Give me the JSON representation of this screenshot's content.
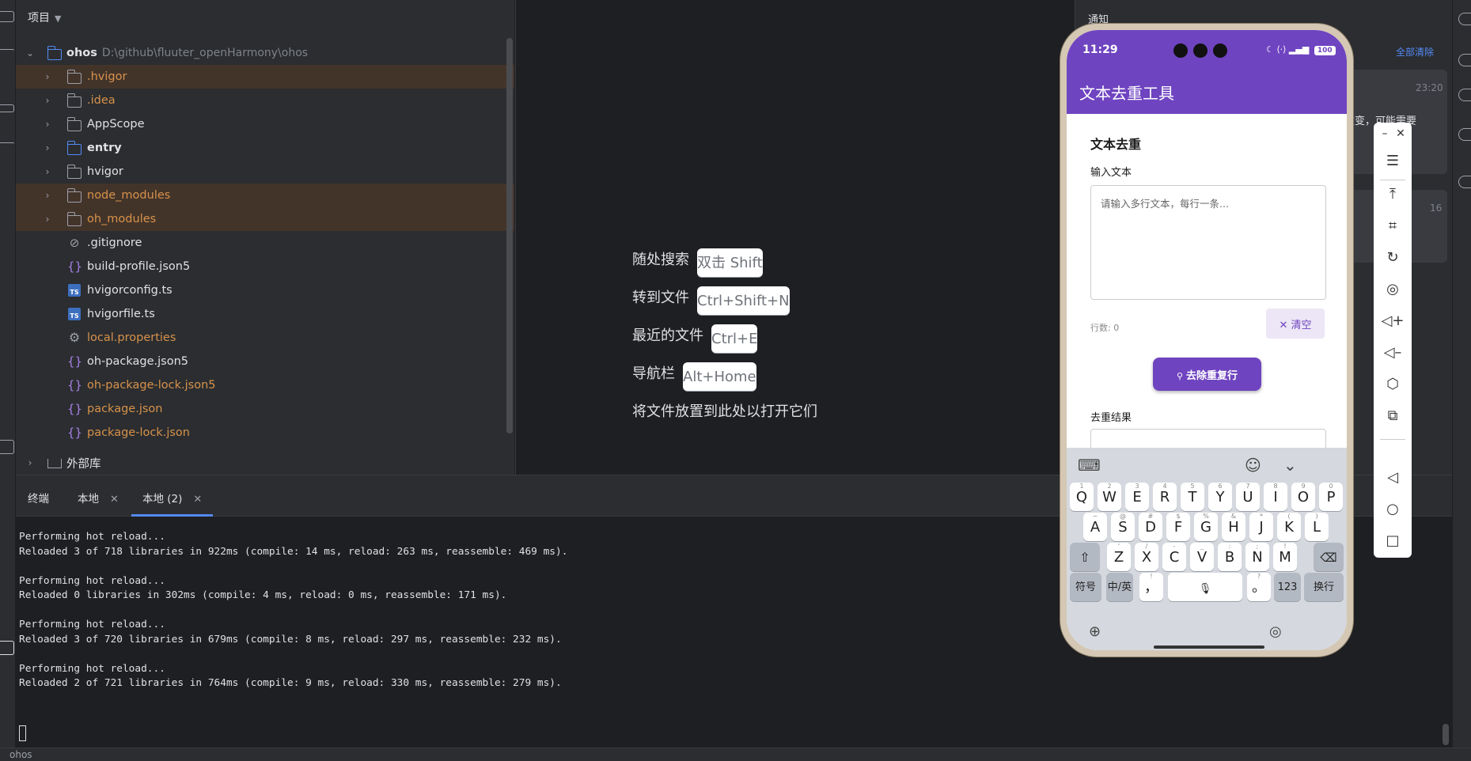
{
  "project_panel": {
    "title": "项目",
    "root": {
      "name": "ohos",
      "path": "D:\\github\\fluuter_openHarmony\\ohos"
    },
    "items": [
      {
        "label": ".hvigor",
        "type": "folder",
        "color": "#d7924b",
        "highlighted": true,
        "expandable": true
      },
      {
        "label": ".idea",
        "type": "folder",
        "color": "#d7924b",
        "highlighted": false,
        "expandable": true
      },
      {
        "label": "AppScope",
        "type": "folder",
        "color": "#dfe1e5",
        "highlighted": false,
        "expandable": true
      },
      {
        "label": "entry",
        "type": "module",
        "color": "#dfe1e5",
        "highlighted": false,
        "expandable": true
      },
      {
        "label": "hvigor",
        "type": "folder",
        "color": "#dfe1e5",
        "highlighted": false,
        "expandable": true
      },
      {
        "label": "node_modules",
        "type": "folder",
        "color": "#d7924b",
        "highlighted": true,
        "expandable": true
      },
      {
        "label": "oh_modules",
        "type": "folder",
        "color": "#d7924b",
        "highlighted": true,
        "expandable": true
      },
      {
        "label": ".gitignore",
        "type": "ignore",
        "color": "#dfe1e5",
        "highlighted": false,
        "expandable": false
      },
      {
        "label": "build-profile.json5",
        "type": "json",
        "color": "#dfe1e5",
        "highlighted": false,
        "expandable": false
      },
      {
        "label": "hvigorconfig.ts",
        "type": "ts",
        "color": "#dfe1e5",
        "highlighted": false,
        "expandable": false
      },
      {
        "label": "hvigorfile.ts",
        "type": "ts",
        "color": "#dfe1e5",
        "highlighted": false,
        "expandable": false
      },
      {
        "label": "local.properties",
        "type": "properties",
        "color": "#d7924b",
        "highlighted": false,
        "expandable": false
      },
      {
        "label": "oh-package.json5",
        "type": "json",
        "color": "#dfe1e5",
        "highlighted": false,
        "expandable": false
      },
      {
        "label": "oh-package-lock.json5",
        "type": "json",
        "color": "#d7924b",
        "highlighted": false,
        "expandable": false
      },
      {
        "label": "package.json",
        "type": "json",
        "color": "#d7924b",
        "highlighted": false,
        "expandable": false
      },
      {
        "label": "package-lock.json",
        "type": "json",
        "color": "#d7924b",
        "highlighted": false,
        "expandable": false
      }
    ],
    "external_libs": "外部库"
  },
  "editor_hints": [
    {
      "label": "随处搜索",
      "key": "双击 Shift"
    },
    {
      "label": "转到文件",
      "key": "Ctrl+Shift+N"
    },
    {
      "label": "最近的文件",
      "key": "Ctrl+E"
    },
    {
      "label": "导航栏",
      "key": "Alt+Home"
    },
    {
      "label": "将文件放置到此处以打开它们",
      "key": ""
    }
  ],
  "notifications": {
    "title": "通知",
    "clear_all": "全部清除",
    "card1_time": "23:20",
    "card1_text": "改变，可能需要",
    "card2_time": "16"
  },
  "terminal": {
    "title": "终端",
    "tabs": [
      {
        "label": "本地",
        "active": false
      },
      {
        "label": "本地 (2)",
        "active": true
      }
    ],
    "lines": [
      "Performing hot reload...",
      "Reloaded 3 of 718 libraries in 922ms (compile: 14 ms, reload: 263 ms, reassemble: 469 ms).",
      "",
      "Performing hot reload...",
      "Reloaded 0 libraries in 302ms (compile: 4 ms, reload: 0 ms, reassemble: 171 ms).",
      "",
      "Performing hot reload...",
      "Reloaded 3 of 720 libraries in 679ms (compile: 8 ms, reload: 297 ms, reassemble: 232 ms).",
      "",
      "Performing hot reload...",
      "Reloaded 2 of 721 libraries in 764ms (compile: 9 ms, reload: 330 ms, reassemble: 279 ms)."
    ]
  },
  "status_bar": {
    "project": "ohos"
  },
  "phone": {
    "time": "11:29",
    "battery": "100",
    "app_title": "文本去重工具",
    "section_title": "文本去重",
    "input_label": "输入文本",
    "input_placeholder": "请输入多行文本，每行一条...",
    "input_value": "",
    "line_count": "行数: 0",
    "clear_label": "清空",
    "dedupe_label": "去除重复行",
    "result_label": "去重结果",
    "accent": "#6f44c0"
  },
  "keyboard": {
    "row1": [
      [
        "Q",
        "1"
      ],
      [
        "W",
        "2"
      ],
      [
        "E",
        "3"
      ],
      [
        "R",
        "4"
      ],
      [
        "T",
        "5"
      ],
      [
        "Y",
        "6"
      ],
      [
        "U",
        "7"
      ],
      [
        "I",
        "8"
      ],
      [
        "O",
        "9"
      ],
      [
        "P",
        "0"
      ]
    ],
    "row2": [
      [
        "A",
        "~"
      ],
      [
        "S",
        "@"
      ],
      [
        "D",
        "#"
      ],
      [
        "F",
        "$"
      ],
      [
        "G",
        "%"
      ],
      [
        "H",
        "&"
      ],
      [
        "J",
        "*"
      ],
      [
        "K",
        "("
      ],
      [
        "L",
        ")"
      ]
    ],
    "row3": [
      [
        "Z",
        "'"
      ],
      [
        "X",
        "/"
      ],
      [
        "C",
        "-"
      ],
      [
        "V",
        "_"
      ],
      [
        "B",
        ":"
      ],
      [
        "N",
        ";"
      ],
      [
        "M",
        "!"
      ]
    ],
    "symbols_key": "符号",
    "lang_key": "中/英",
    "comma_key": "，",
    "comma_sup": "!",
    "period_key": "。",
    "period_sup": "?",
    "num_key": "123",
    "enter_key": "换行"
  }
}
